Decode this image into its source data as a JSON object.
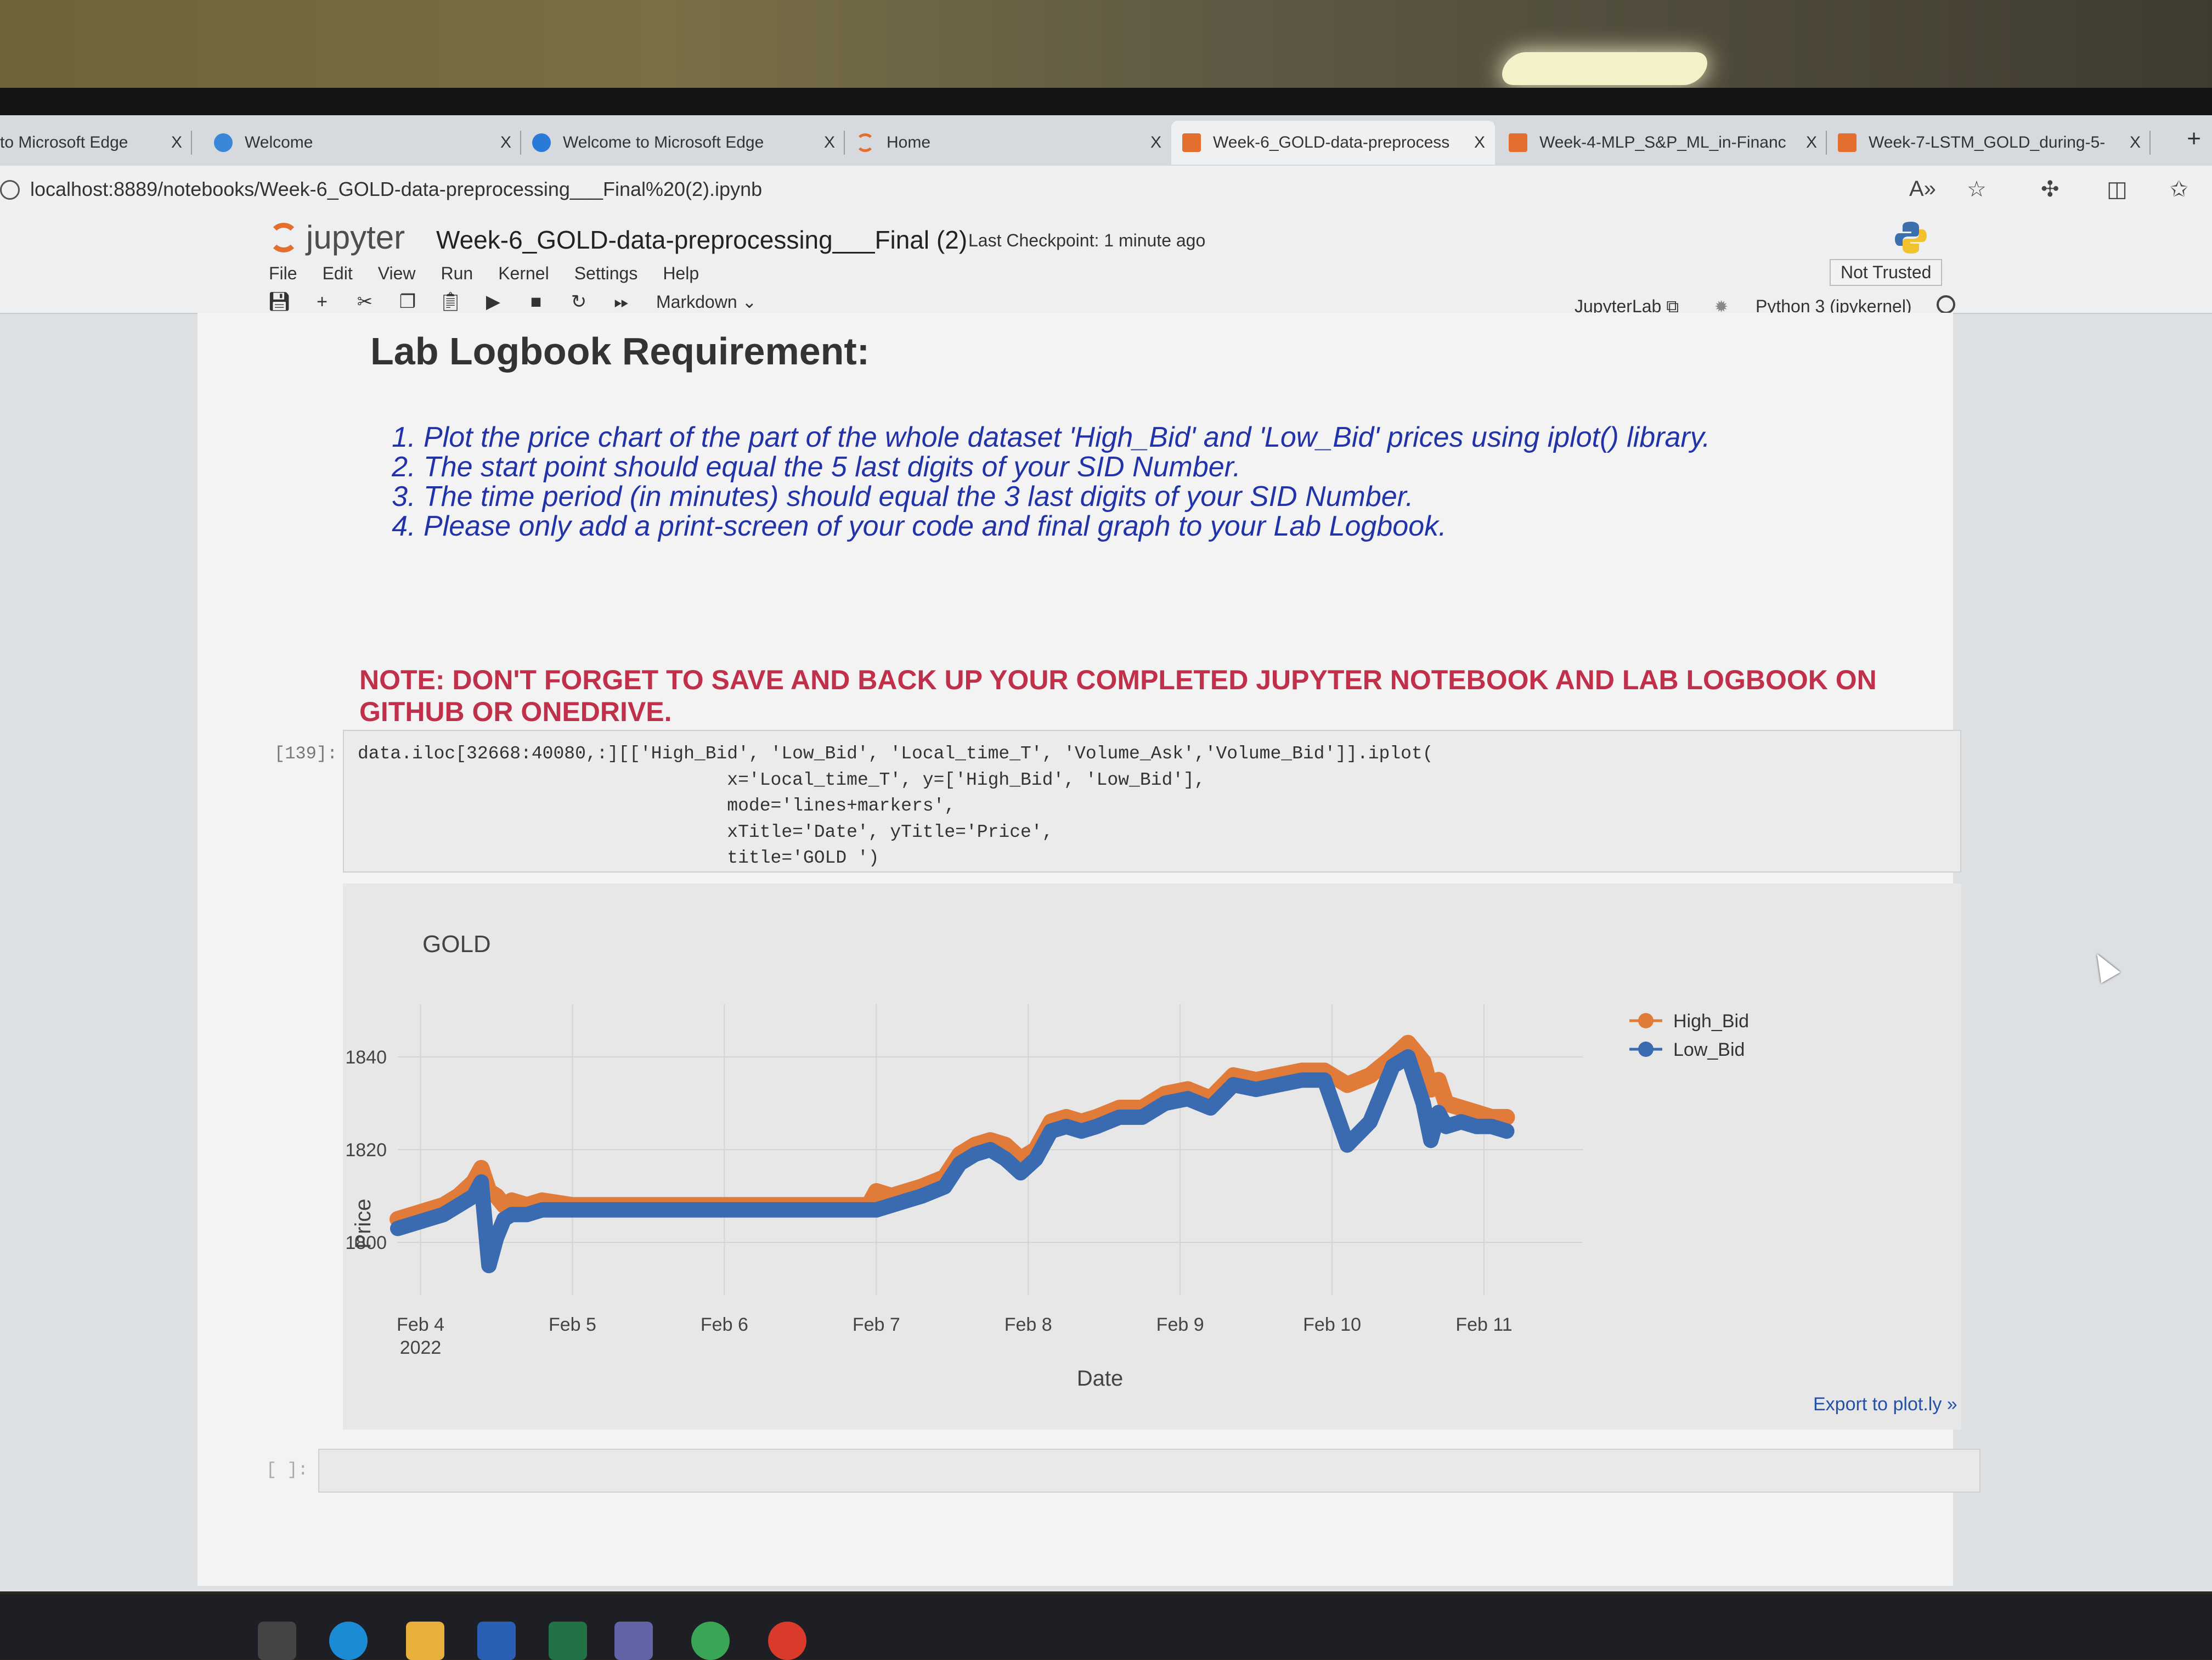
{
  "browser": {
    "tabs": [
      {
        "label": "to Microsoft Edge",
        "close": "X",
        "color": "#1e6fd6"
      },
      {
        "label": "Welcome",
        "close": "X",
        "color": "#3a86d8"
      },
      {
        "label": "Welcome to Microsoft Edge",
        "close": "X",
        "color": "#2a7bd8"
      },
      {
        "label": "Home",
        "close": "X",
        "color": "#e46e2e"
      },
      {
        "label": "Week-6_GOLD-data-preprocess",
        "close": "X",
        "color": "#e46e2e"
      },
      {
        "label": "Week-4-MLP_S&P_ML_in-Financ",
        "close": "X",
        "color": "#e46e2e"
      },
      {
        "label": "Week-7-LSTM_GOLD_during-5-",
        "close": "X",
        "color": "#e46e2e"
      }
    ],
    "new_tab": "+",
    "url": "localhost:8889/notebooks/Week-6_GOLD-data-preprocessing___Final%20(2).ipynb",
    "icons": [
      "read-aloud-icon",
      "favorite-star-icon",
      "extensions-icon",
      "split-screen-icon",
      "favorites-icon"
    ]
  },
  "jupyter": {
    "logo_text": "jupyter",
    "notebook_name": "Week-6_GOLD-data-preprocessing___Final (2)",
    "checkpoint": "Last Checkpoint: 1 minute ago",
    "menu": [
      "File",
      "Edit",
      "View",
      "Run",
      "Kernel",
      "Settings",
      "Help"
    ],
    "not_trusted": "Not Trusted",
    "cell_type": "Markdown ⌄",
    "jupyterlab_link": "JupyterLab ⧉",
    "kernel": "Python 3 (ipykernel)"
  },
  "markdown": {
    "heading": "Lab Logbook Requirement:",
    "requirements": [
      "Plot the price chart of the part of the whole dataset 'High_Bid' and 'Low_Bid' prices using iplot() library.",
      "The start point should equal the 5 last digits of your SID Number.",
      "The time period (in minutes) should equal the 3 last digits of your SID Number.",
      "Please only add a print-screen of your code and final graph to your Lab Logbook."
    ],
    "note": "NOTE: DON'T FORGET TO SAVE AND BACK UP YOUR COMPLETED JUPYTER NOTEBOOK AND LAB LOGBOOK ON GITHUB OR ONEDRIVE."
  },
  "code_cell": {
    "prompt": "[139]:",
    "lines": [
      "data.iloc[32668:40080,:][['High_Bid', 'Low_Bid', 'Local_time_T', 'Volume_Ask','Volume_Bid']].iplot(",
      "                                  x='Local_time_T', y=['High_Bid', 'Low_Bid'],",
      "                                  mode='lines+markers',",
      "                                  xTitle='Date', yTitle='Price',",
      "                                  title='GOLD ')"
    ]
  },
  "empty_cell": {
    "prompt": "[ ]:"
  },
  "export_link": "Export to plot.ly »",
  "chart_data": {
    "type": "line",
    "title": "GOLD",
    "xlabel": "Date",
    "ylabel": "Price",
    "x_ticks": [
      "Feb 4\n2022",
      "Feb 5",
      "Feb 6",
      "Feb 7",
      "Feb 8",
      "Feb 9",
      "Feb 10",
      "Feb 11"
    ],
    "y_ticks": [
      1800,
      1820,
      1840
    ],
    "xlim": [
      3.85,
      11.65
    ],
    "ylim": [
      1791,
      1849
    ],
    "legend_position": "top-right",
    "grid": true,
    "series": [
      {
        "name": "High_Bid",
        "color": "#e07b39",
        "x": [
          3.85,
          3.95,
          4.05,
          4.15,
          4.25,
          4.35,
          4.4,
          4.45,
          4.5,
          4.55,
          4.6,
          4.7,
          4.8,
          5.0,
          6.0,
          6.95,
          7.0,
          7.1,
          7.2,
          7.3,
          7.45,
          7.55,
          7.65,
          7.75,
          7.85,
          7.95,
          8.05,
          8.15,
          8.25,
          8.35,
          8.45,
          8.6,
          8.75,
          8.9,
          9.05,
          9.2,
          9.35,
          9.5,
          9.65,
          9.8,
          9.95,
          10.1,
          10.25,
          10.4,
          10.5,
          10.6,
          10.65,
          10.7,
          10.75,
          10.85,
          10.95,
          11.05,
          11.15
        ],
        "y": [
          1805,
          1806,
          1807,
          1808,
          1810,
          1813,
          1816,
          1811,
          1810,
          1808,
          1809,
          1808,
          1809,
          1808,
          1808,
          1808,
          1811,
          1810,
          1811,
          1812,
          1814,
          1819,
          1821,
          1822,
          1821,
          1818,
          1820,
          1826,
          1827,
          1826,
          1827,
          1829,
          1829,
          1832,
          1833,
          1831,
          1836,
          1835,
          1836,
          1837,
          1837,
          1834,
          1836,
          1840,
          1843,
          1839,
          1833,
          1835,
          1830,
          1829,
          1828,
          1827,
          1827
        ]
      },
      {
        "name": "Low_Bid",
        "color": "#3a6ab0",
        "x": [
          3.85,
          3.95,
          4.05,
          4.15,
          4.25,
          4.35,
          4.4,
          4.45,
          4.5,
          4.55,
          4.6,
          4.7,
          4.8,
          5.0,
          6.0,
          6.95,
          7.0,
          7.1,
          7.2,
          7.3,
          7.45,
          7.55,
          7.65,
          7.75,
          7.85,
          7.95,
          8.05,
          8.15,
          8.25,
          8.35,
          8.45,
          8.6,
          8.75,
          8.9,
          9.05,
          9.2,
          9.35,
          9.5,
          9.65,
          9.8,
          9.95,
          10.1,
          10.25,
          10.4,
          10.5,
          10.6,
          10.65,
          10.7,
          10.75,
          10.85,
          10.95,
          11.05,
          11.15
        ],
        "y": [
          1803,
          1804,
          1805,
          1806,
          1808,
          1810,
          1813,
          1795,
          1801,
          1805,
          1806,
          1806,
          1807,
          1807,
          1807,
          1807,
          1807,
          1808,
          1809,
          1810,
          1812,
          1817,
          1819,
          1820,
          1818,
          1815,
          1818,
          1824,
          1825,
          1824,
          1825,
          1827,
          1827,
          1830,
          1831,
          1829,
          1834,
          1833,
          1834,
          1835,
          1835,
          1821,
          1826,
          1838,
          1840,
          1830,
          1822,
          1828,
          1825,
          1826,
          1825,
          1825,
          1824
        ]
      }
    ]
  }
}
